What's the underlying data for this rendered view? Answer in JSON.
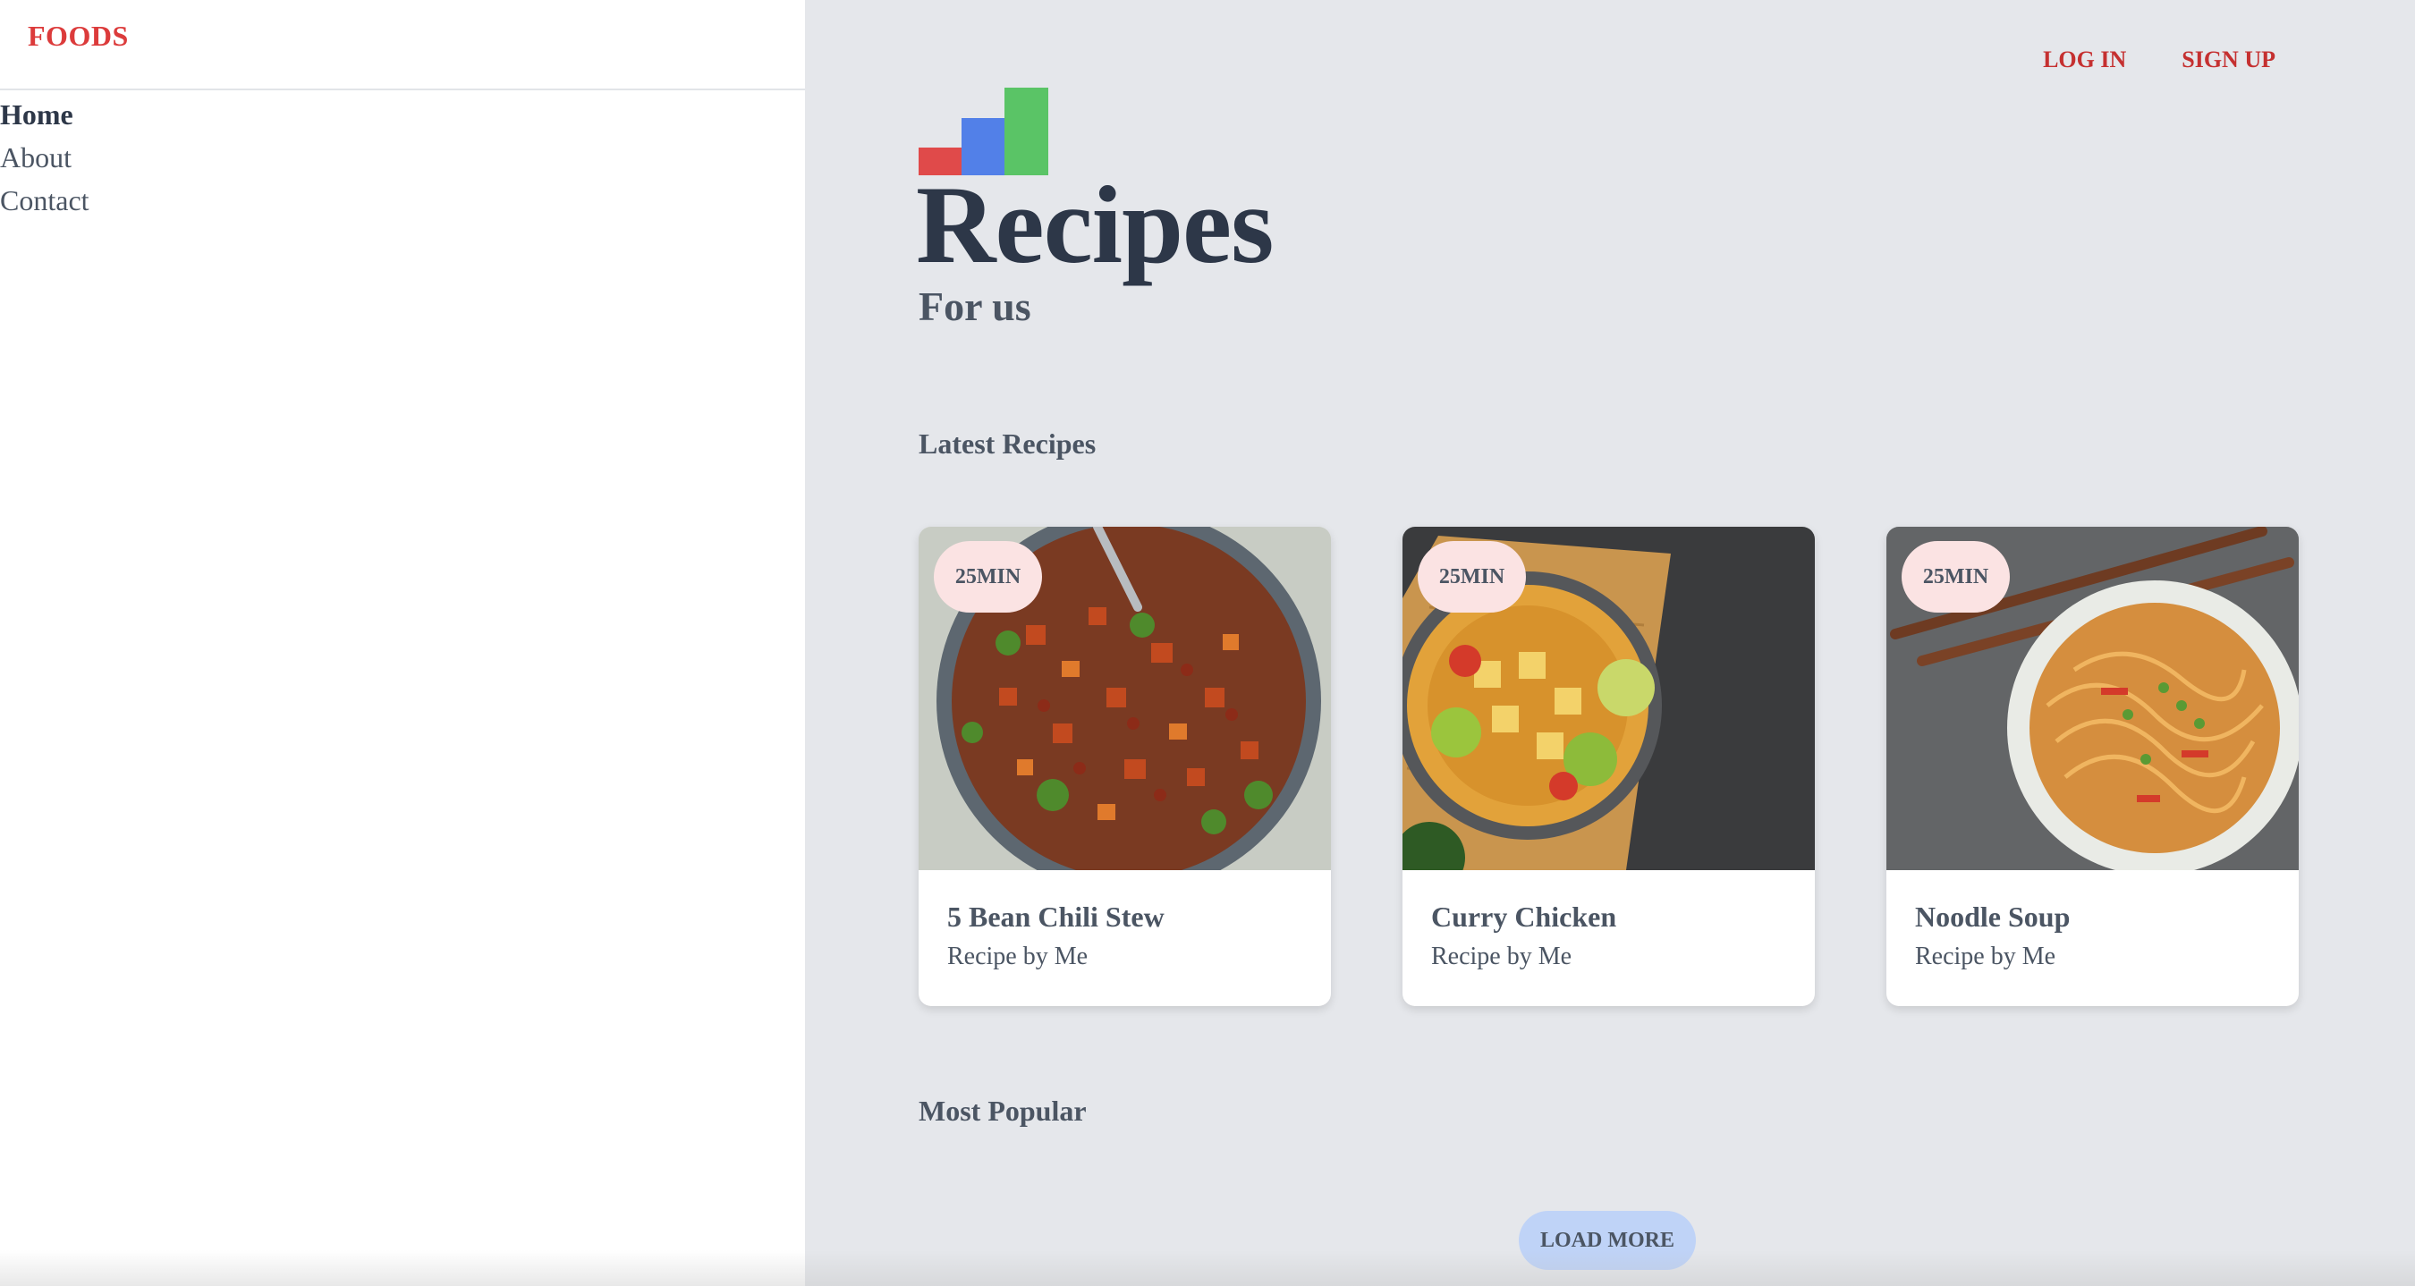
{
  "sidebar": {
    "brand": "FOODS",
    "nav": [
      {
        "label": "Home",
        "active": true
      },
      {
        "label": "About",
        "active": false
      },
      {
        "label": "Contact",
        "active": false
      }
    ]
  },
  "header": {
    "login_label": "LOG IN",
    "signup_label": "SIGN UP",
    "accent_color": "#c53030"
  },
  "hero": {
    "title": "Recipes",
    "subtitle": "For us",
    "logo_colors": [
      "#e04a4a",
      "#5280e8",
      "#5ac466"
    ]
  },
  "latest": {
    "heading": "Latest Recipes",
    "cards": [
      {
        "badge": "25MIN",
        "title": "5 Bean Chili Stew",
        "author": "Recipe by Me",
        "image_icon": "chili-stew-photo"
      },
      {
        "badge": "25MIN",
        "title": "Curry Chicken",
        "author": "Recipe by Me",
        "image_icon": "curry-bowl-photo"
      },
      {
        "badge": "25MIN",
        "title": "Noodle Soup",
        "author": "Recipe by Me",
        "image_icon": "noodle-bowl-photo"
      }
    ]
  },
  "popular": {
    "heading": "Most Popular"
  },
  "load_more_label": "LOAD MORE"
}
